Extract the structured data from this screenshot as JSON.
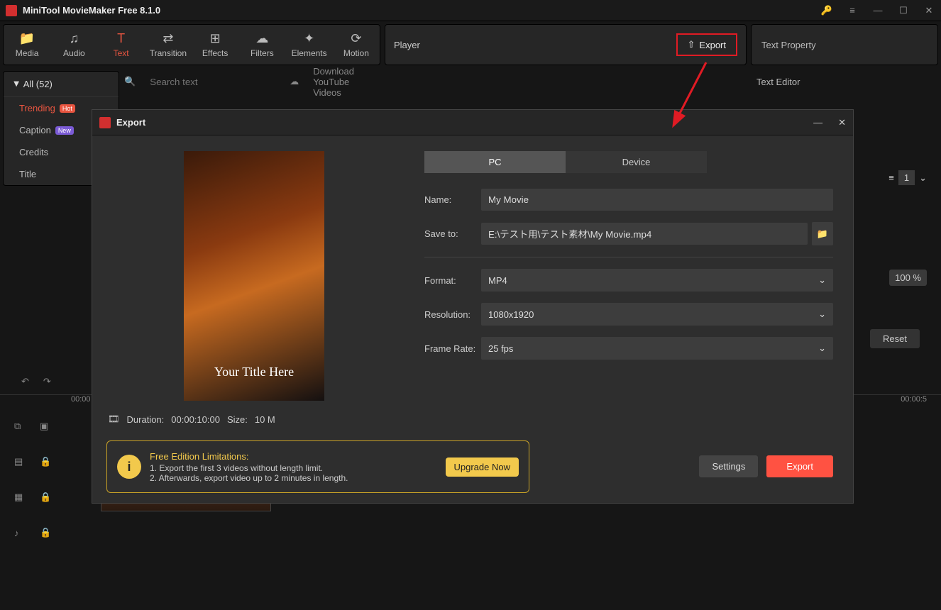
{
  "app": {
    "title": "MiniTool MovieMaker Free 8.1.0"
  },
  "toolbar": {
    "tabs": [
      "Media",
      "Audio",
      "Text",
      "Transition",
      "Effects",
      "Filters",
      "Elements",
      "Motion"
    ],
    "active_index": 2
  },
  "player_label": "Player",
  "export_label": "Export",
  "text_property": "Text Property",
  "sidebar": {
    "all_label": "All (52)",
    "search_placeholder": "Search text",
    "download_label": "Download YouTube Videos",
    "cats": [
      {
        "label": "Trending",
        "badge": "Hot"
      },
      {
        "label": "Caption",
        "badge": "New"
      },
      {
        "label": "Credits",
        "badge": ""
      },
      {
        "label": "Title",
        "badge": ""
      }
    ]
  },
  "text_editor_label": "Text Editor",
  "modal": {
    "title": "Export",
    "tabs": {
      "pc": "PC",
      "device": "Device",
      "active": "pc"
    },
    "fields": {
      "name_label": "Name:",
      "name_value": "My Movie",
      "save_label": "Save to:",
      "save_value": "E:\\テスト用\\テスト素材\\My Movie.mp4",
      "format_label": "Format:",
      "format_value": "MP4",
      "resolution_label": "Resolution:",
      "resolution_value": "1080x1920",
      "framerate_label": "Frame Rate:",
      "framerate_value": "25 fps"
    },
    "preview_text": "Your Title Here",
    "duration_label": "Duration:",
    "duration_value": "00:00:10:00",
    "size_label": "Size:",
    "size_value": "10 M",
    "limitations": {
      "title": "Free Edition Limitations:",
      "line1": "1. Export the first 3 videos without length limit.",
      "line2": "2. Afterwards, export video up to 2 minutes in length.",
      "upgrade": "Upgrade Now"
    },
    "settings": "Settings",
    "export": "Export"
  },
  "right": {
    "zoom": "100 %",
    "reset": "Reset",
    "spin": "1"
  },
  "timeline": {
    "t0": "00:00",
    "t1": "00:00:5"
  }
}
